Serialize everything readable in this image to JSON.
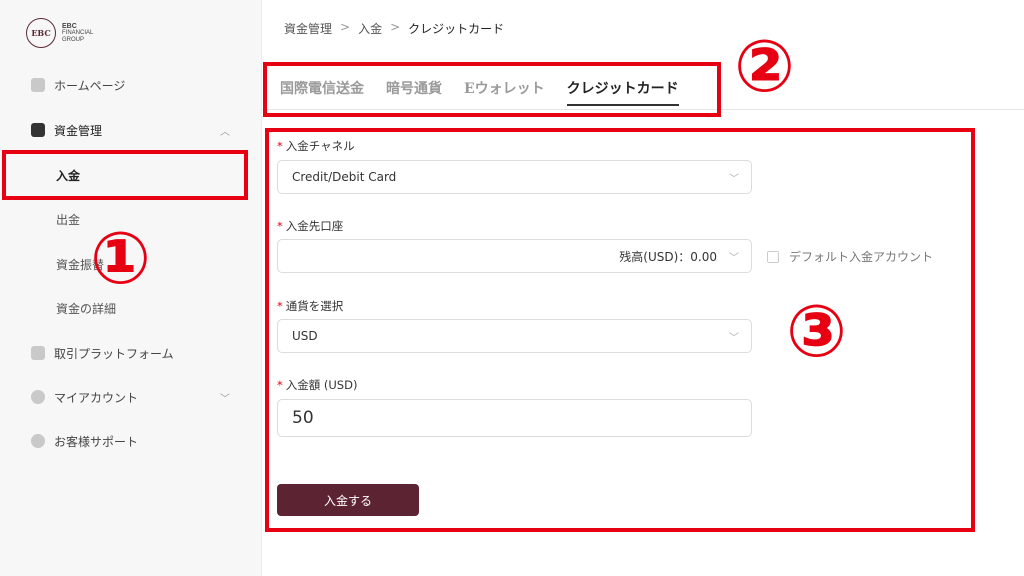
{
  "logo": {
    "mark": "EBC",
    "line1": "EBC",
    "line2": "FINANCIAL",
    "line3": "GROUP"
  },
  "sidebar": {
    "items": [
      {
        "label": "ホームページ"
      },
      {
        "label": "資金管理"
      },
      {
        "label": "取引プラットフォーム"
      },
      {
        "label": "マイアカウント"
      },
      {
        "label": "お客様サポート"
      }
    ],
    "sub_items": [
      {
        "label": "入金"
      },
      {
        "label": "出金"
      },
      {
        "label": "資金振替"
      },
      {
        "label": "資金の詳細"
      }
    ],
    "chev_up": "︿",
    "chev_down": "﹀"
  },
  "breadcrumb": {
    "a": "資金管理",
    "b": "入金",
    "c": "クレジットカード",
    "sep": ">"
  },
  "tabs": [
    {
      "label": "国際電信送金"
    },
    {
      "label": "暗号通貨"
    },
    {
      "label": "Eウォレット"
    },
    {
      "label": "クレジットカード"
    }
  ],
  "form": {
    "req": "*",
    "channel_label": "入金チャネル",
    "channel_value": "Credit/Debit Card",
    "account_label": "入金先口座",
    "account_value": "残高(USD)：0.00",
    "default_account_label": "デフォルト入金アカウント",
    "currency_label": "通貨を選択",
    "currency_value": "USD",
    "amount_label": "入金額 (USD)",
    "amount_value": "50",
    "submit_label": "入金する",
    "chev": "﹀"
  },
  "annotations": {
    "n1": "①",
    "n2": "②",
    "n3": "③"
  },
  "colors": {
    "accent": "#5c2433",
    "annotation": "#e60012"
  }
}
